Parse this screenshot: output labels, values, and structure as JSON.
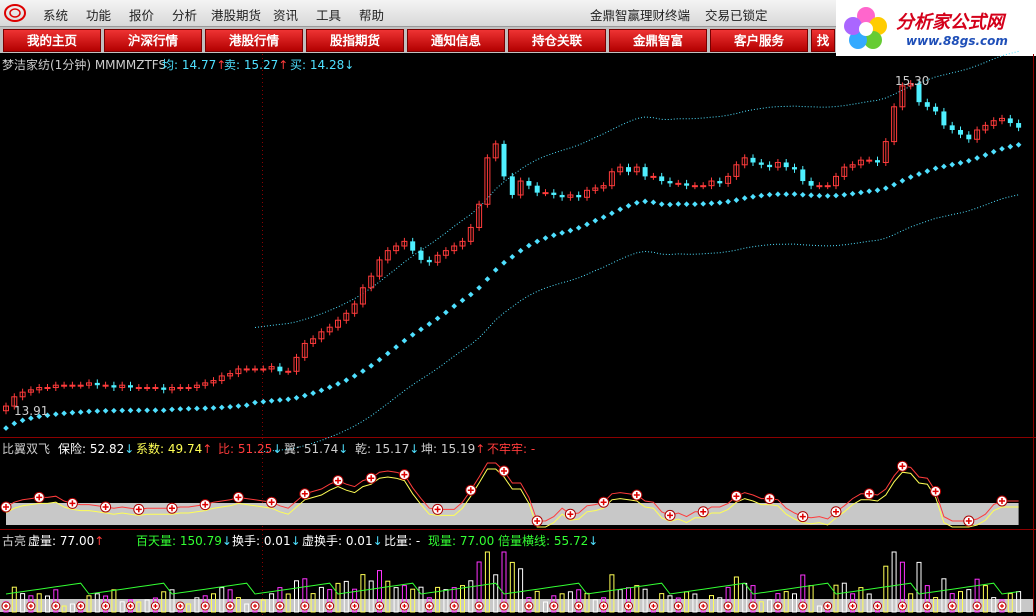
{
  "menu": [
    "系统",
    "功能",
    "报价",
    "分析",
    "港股期货",
    "资讯",
    "工具",
    "帮助"
  ],
  "app_title": "金鼎智赢理财终端",
  "lock_status": "交易已锁定",
  "brand": {
    "name": "分析家公式网",
    "url": "www.88gs.com"
  },
  "tabs": [
    "我的主页",
    "沪深行情",
    "港股行情",
    "股指期货",
    "通知信息",
    "持仓关联",
    "金鼎智富",
    "客户服务",
    "找"
  ],
  "main_panel": {
    "title": "梦洁家纺(1分钟) MMMMZTFS",
    "avg_label": "均: 14.77",
    "sell_label": "卖: 15.27",
    "buy_label": "买: 14.28",
    "high_label": "15.30",
    "low_label": "13.91"
  },
  "mid_panel": {
    "title": "比翼双飞",
    "items": [
      "保险: 52.82",
      "系数: 49.74",
      "比: 51.25",
      "翼: 51.74",
      "乾: 15.17",
      "坤: 15.19",
      "不牢牢: -"
    ]
  },
  "vol_panel": {
    "title": "古亮",
    "items": [
      "虚量: 77.00",
      "百天量: 150.79",
      "换手: 0.01",
      "虚换手: 0.01",
      "比量: -",
      "现量: 77.00",
      "倍量横线: 55.72"
    ]
  },
  "colors": {
    "up": "#ff3b3b",
    "down": "#4ff0ff",
    "magenta": "#ff33ff",
    "yellow": "#ffff55",
    "green": "#33ff33",
    "border": "#8b0000"
  },
  "chart_data": {
    "type": "candlestick",
    "close": [
      13.91,
      13.95,
      13.97,
      13.98,
      13.99,
      13.99,
      14.0,
      14.0,
      14.0,
      14.0,
      14.01,
      14.0,
      14.0,
      13.99,
      14.0,
      13.99,
      13.99,
      13.99,
      13.99,
      13.98,
      13.99,
      13.99,
      13.99,
      14.0,
      14.01,
      14.02,
      14.04,
      14.05,
      14.07,
      14.07,
      14.07,
      14.07,
      14.08,
      14.06,
      14.06,
      14.12,
      14.18,
      14.2,
      14.23,
      14.25,
      14.28,
      14.31,
      14.35,
      14.42,
      14.47,
      14.54,
      14.58,
      14.6,
      14.62,
      14.58,
      14.54,
      14.53,
      14.56,
      14.58,
      14.6,
      14.62,
      14.68,
      14.78,
      14.98,
      15.04,
      14.9,
      14.82,
      14.88,
      14.86,
      14.83,
      14.83,
      14.82,
      14.81,
      14.82,
      14.81,
      14.84,
      14.85,
      14.86,
      14.92,
      14.94,
      14.92,
      14.94,
      14.9,
      14.9,
      14.88,
      14.87,
      14.87,
      14.86,
      14.86,
      14.86,
      14.88,
      14.87,
      14.9,
      14.95,
      14.98,
      14.96,
      14.95,
      14.94,
      14.96,
      14.94,
      14.93,
      14.88,
      14.86,
      14.86,
      14.86,
      14.9,
      14.94,
      14.95,
      14.97,
      14.97,
      14.96,
      15.05,
      15.2,
      15.29,
      15.3,
      15.22,
      15.2,
      15.18,
      15.12,
      15.1,
      15.08,
      15.06,
      15.1,
      15.12,
      15.14,
      15.15,
      15.13,
      15.11
    ],
    "ylim": [
      13.85,
      15.35
    ]
  }
}
